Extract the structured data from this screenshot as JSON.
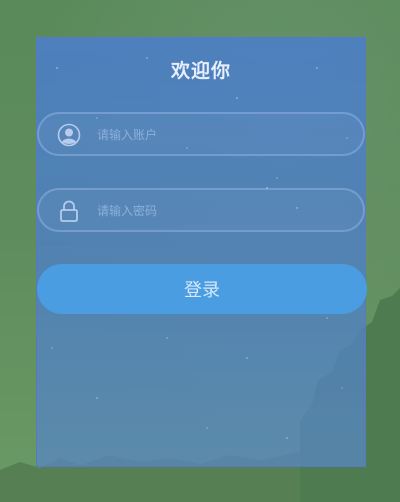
{
  "login": {
    "title": "欢迎你",
    "username": {
      "placeholder": "请输入账户",
      "value": "",
      "icon": "user-icon"
    },
    "password": {
      "placeholder": "请输入密码",
      "value": "",
      "icon": "lock-icon"
    },
    "submit_label": "登录"
  },
  "colors": {
    "panel": "#4a7ecd",
    "button": "#4a9de0",
    "background": "#5e8b5a"
  }
}
